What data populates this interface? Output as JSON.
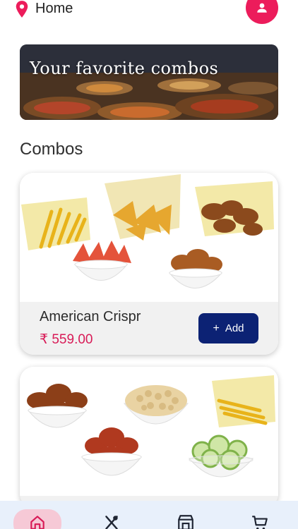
{
  "header": {
    "location_label": "Home",
    "location_icon": "location-pin-icon",
    "profile_icon": "user-icon",
    "accent_color": "#ec1c5b"
  },
  "banner": {
    "title": "Your favorite combos"
  },
  "section": {
    "title": "Combos"
  },
  "cards": [
    {
      "name": "American Crispr",
      "price": "₹ 559.00",
      "add_label": "Add",
      "add_icon": "plus-icon"
    },
    {
      "name": "",
      "price": "",
      "add_label": "",
      "add_icon": "plus-icon"
    }
  ],
  "bottom_nav": {
    "items": [
      {
        "icon": "home-icon",
        "active": true
      },
      {
        "icon": "fork-knife-icon",
        "active": false
      },
      {
        "icon": "store-icon",
        "active": false
      },
      {
        "icon": "cart-icon",
        "active": false
      }
    ],
    "active_color": "#d81b57",
    "inactive_color": "#1f2533"
  },
  "colors": {
    "price": "#d81b57",
    "add_button": "#0c2274",
    "nav_background": "#e8f0fb",
    "nav_active_pill": "#f6c9d6"
  }
}
